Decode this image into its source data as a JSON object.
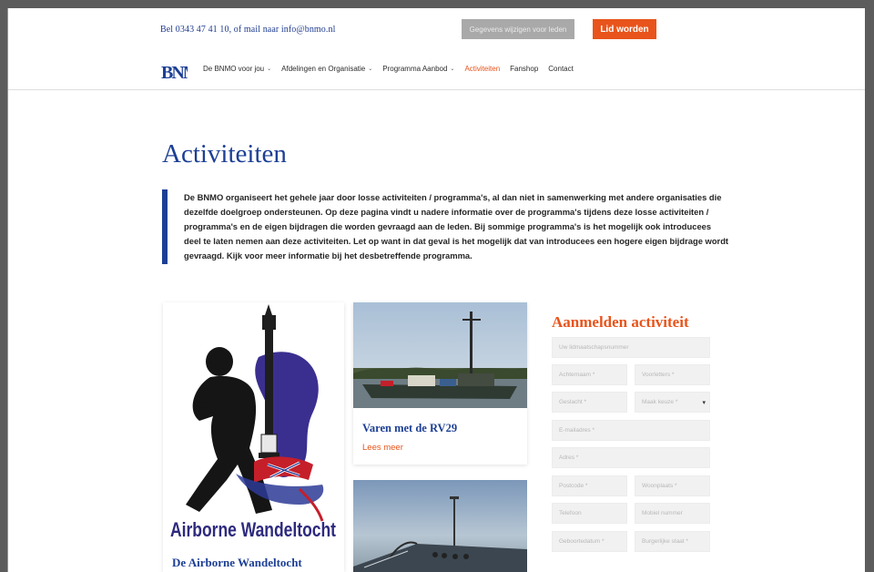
{
  "topbar": {
    "contact": "Bel 0343 47 41 10, of mail naar info@bnmo.nl",
    "grey_button": "Gegevens wijzigen voor leden",
    "orange_button": "Lid worden"
  },
  "nav": {
    "items": [
      {
        "label": "De BNMO voor jou",
        "dropdown": true,
        "active": false
      },
      {
        "label": "Afdelingen en Organisatie",
        "dropdown": true,
        "active": false
      },
      {
        "label": "Programma Aanbod",
        "dropdown": true,
        "active": false
      },
      {
        "label": "Activiteiten",
        "dropdown": false,
        "active": true
      },
      {
        "label": "Fanshop",
        "dropdown": false,
        "active": false
      },
      {
        "label": "Contact",
        "dropdown": false,
        "active": false
      }
    ],
    "chevron": "⌄"
  },
  "page": {
    "title": "Activiteiten",
    "intro": "De BNMO organiseert het gehele jaar door losse activiteiten / programma's, al dan niet in samenwerking met andere organisaties die dezelfde doelgroep ondersteunen. Op deze pagina vindt u nadere informatie over de programma's tijdens deze losse activiteiten / programma's en de eigen bijdragen die worden gevraagd aan de leden. Bij sommige programma's is het mogelijk ook introducees deel te laten nemen aan deze activiteiten. Let op want in dat geval is het mogelijk dat van introducees een hogere eigen bijdrage wordt gevraagd. Kijk voor meer informatie bij het desbetreffende programma."
  },
  "cards": {
    "left": {
      "logo_text": "Airborne Wandeltocht",
      "title": "De Airborne Wandeltocht"
    },
    "mid": {
      "title": "Varen met de RV29",
      "more": "Lees meer"
    }
  },
  "form": {
    "title": "Aanmelden activiteit",
    "fields": {
      "member_number": "Uw lidmaatschapsnummer",
      "first_name": "Achternaam *",
      "initials": "Voorletters *",
      "prefix": "Geslacht *",
      "gender": "Maak keuze *",
      "email": "E-mailadres *",
      "address": "Adres *",
      "postal_code": "Postcode *",
      "city": "Woonplaats *",
      "phone": "Telefoon",
      "mobile": "Mobiel nummer",
      "birthdate": "Geboortedatum *",
      "birthplace": "Burgerlijke staat *"
    },
    "caret": "▾"
  },
  "colors": {
    "brand_blue": "#1c3f95",
    "accent_orange": "#e8541b",
    "button_grey": "#a9a9a9"
  }
}
